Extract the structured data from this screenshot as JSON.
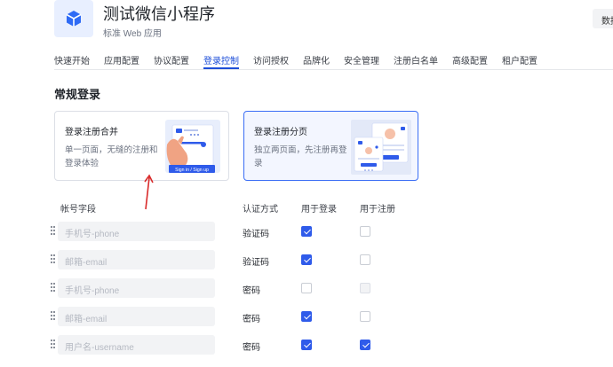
{
  "app": {
    "title": "测试微信小程序",
    "subtitle": "标准 Web 应用",
    "top_right_button": "数据"
  },
  "tabs": [
    {
      "label": "快速开始",
      "active": false
    },
    {
      "label": "应用配置",
      "active": false
    },
    {
      "label": "协议配置",
      "active": false
    },
    {
      "label": "登录控制",
      "active": true
    },
    {
      "label": "访问授权",
      "active": false
    },
    {
      "label": "品牌化",
      "active": false
    },
    {
      "label": "安全管理",
      "active": false
    },
    {
      "label": "注册白名单",
      "active": false
    },
    {
      "label": "高级配置",
      "active": false
    },
    {
      "label": "租户配置",
      "active": false
    }
  ],
  "section": {
    "title": "常规登录"
  },
  "cards": [
    {
      "title": "登录注册合并",
      "desc": "单一页面，无缝的注册和登录体验",
      "button_text": "Sign in / Sign up",
      "selected": false
    },
    {
      "title": "登录注册分页",
      "desc": "独立两页面，先注册再登录",
      "selected": true
    }
  ],
  "table": {
    "headers": {
      "field": "帐号字段",
      "method": "认证方式",
      "login": "用于登录",
      "register": "用于注册"
    },
    "rows": [
      {
        "field": "手机号-phone",
        "method": "验证码",
        "login": "checked",
        "register": "unchecked"
      },
      {
        "field": "邮箱-email",
        "method": "验证码",
        "login": "checked",
        "register": "unchecked"
      },
      {
        "field": "手机号-phone",
        "method": "密码",
        "login": "unchecked",
        "register": "disabled"
      },
      {
        "field": "邮箱-email",
        "method": "密码",
        "login": "checked",
        "register": "unchecked"
      },
      {
        "field": "用户名-username",
        "method": "密码",
        "login": "checked",
        "register": "checked"
      }
    ]
  },
  "colors": {
    "accent": "#2f5bea",
    "active_tab": "#1d4ed8",
    "arrow": "#d92b2b"
  }
}
